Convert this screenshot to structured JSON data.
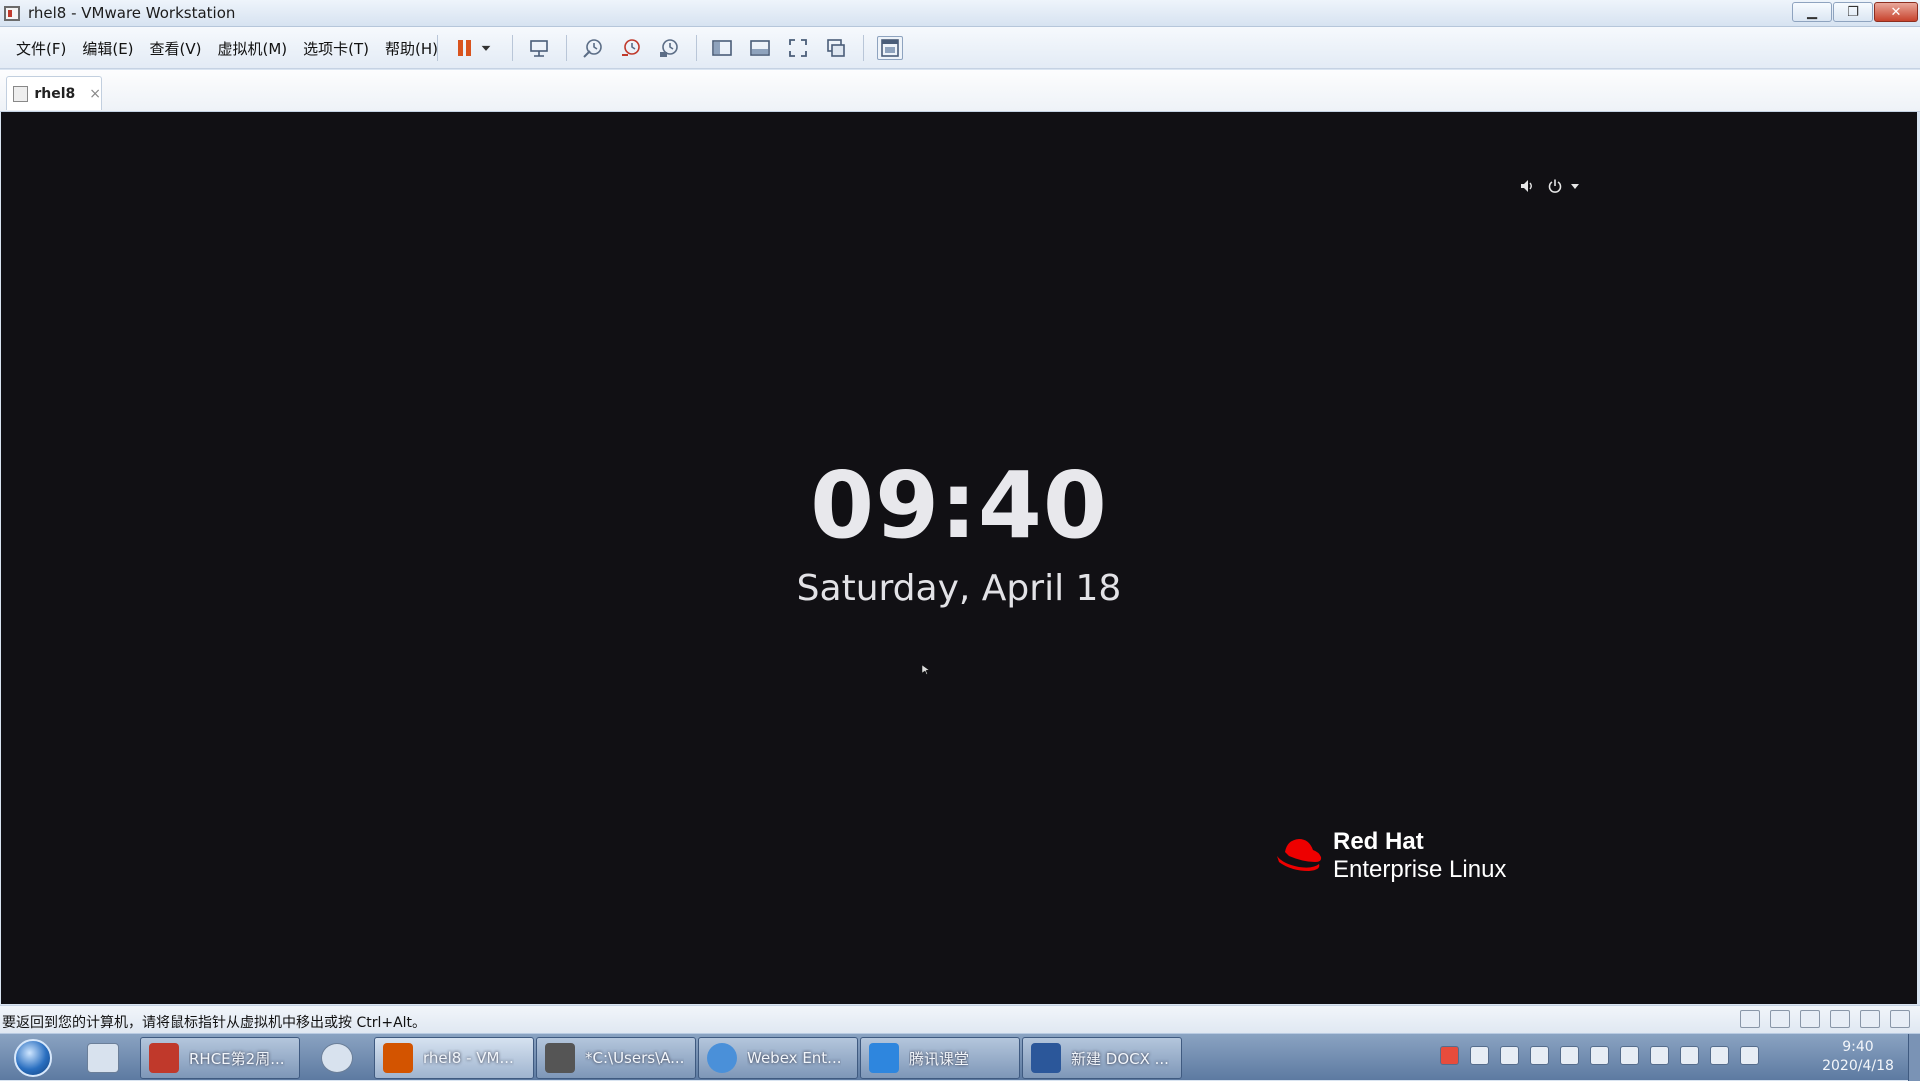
{
  "window": {
    "title": "rhel8 - VMware Workstation",
    "minimize": "▁",
    "restore": "❐",
    "close": "✕"
  },
  "menu": {
    "file": "文件(F)",
    "edit": "编辑(E)",
    "view": "查看(V)",
    "vm": "虚拟机(M)",
    "tabs": "选项卡(T)",
    "help": "帮助(H)"
  },
  "tab": {
    "label": "rhel8",
    "close": "×"
  },
  "guest": {
    "time": "09:40",
    "date": "Saturday, April 18",
    "brand_line1": "Red Hat",
    "brand_line2": "Enterprise Linux",
    "status_icons": [
      "volume-icon",
      "power-icon",
      "chevron-down-icon"
    ]
  },
  "hint": {
    "text": "要返回到您的计算机，请将鼠标指针从虚拟机中移出或按 Ctrl+Alt。"
  },
  "taskbar": {
    "tasks": [
      {
        "label": "RHCE第2周...",
        "icon": "document-icon",
        "color": "#c0392b"
      },
      {
        "label": "rhel8 - VM...",
        "icon": "vmware-icon",
        "color": "#d35400"
      },
      {
        "label": "*C:\\Users\\A...",
        "icon": "editor-icon",
        "color": "#555555"
      },
      {
        "label": "Webex Ent...",
        "icon": "webex-icon",
        "color": "#4a90d9"
      },
      {
        "label": "腾讯课堂",
        "icon": "tencent-class-icon",
        "color": "#2e86de"
      },
      {
        "label": "新建 DOCX ...",
        "icon": "word-icon",
        "color": "#2b579a"
      }
    ],
    "time": "9:40",
    "date": "2020/4/18"
  },
  "colors": {
    "accent_red": "#ee0000",
    "vm_background": "#111014"
  }
}
